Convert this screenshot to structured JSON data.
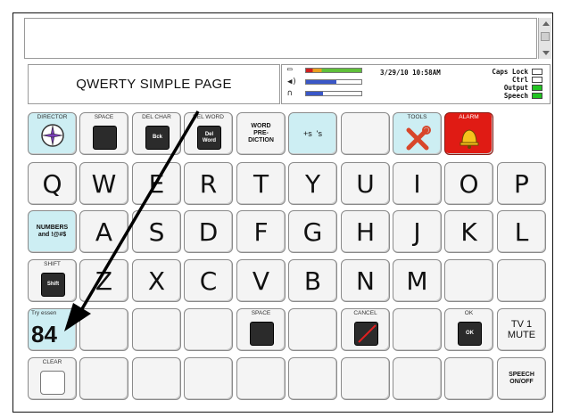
{
  "page_title": "QWERTY SIMPLE PAGE",
  "status": {
    "datetime": "3/29/10 10:58AM",
    "flags": [
      "Caps Lock",
      "Ctrl",
      "Output",
      "Speech"
    ],
    "flag_states": [
      false,
      false,
      true,
      true
    ]
  },
  "row0": {
    "director": "DIRECTOR",
    "space": "SPACE",
    "del_char": "DEL CHAR",
    "del_char_btn": "Bck",
    "del_word": "DEL WORD",
    "del_word_btn": "Del Word",
    "word_prediction": "WORD PRE- DICTION",
    "plural": "+s  's",
    "tools": "TOOLS",
    "alarm": "ALARM"
  },
  "row1": [
    "Q",
    "W",
    "E",
    "R",
    "T",
    "Y",
    "U",
    "I",
    "O",
    "P"
  ],
  "row2": {
    "numbers": "NUMBERS and !@#$",
    "letters": [
      "A",
      "S",
      "D",
      "F",
      "G",
      "H",
      "J",
      "K",
      "L"
    ]
  },
  "row3": {
    "shift": "SHIFT",
    "shift_btn": "Shift",
    "letters": [
      "Z",
      "X",
      "C",
      "V",
      "B",
      "N",
      "M"
    ]
  },
  "row4": {
    "try_label": "Try essen",
    "try_number": "84",
    "space": "SPACE",
    "cancel": "CANCEL",
    "ok_label": "OK",
    "ok_btn": "OK",
    "tv_mute": "TV 1 MUTE"
  },
  "row5": {
    "clear": "CLEAR",
    "speech": "SPEECH ON/OFF"
  },
  "colors": {
    "teal_key": "#cdeef3",
    "alarm_red": "#e01b14",
    "green_indicator": "#22c322"
  }
}
